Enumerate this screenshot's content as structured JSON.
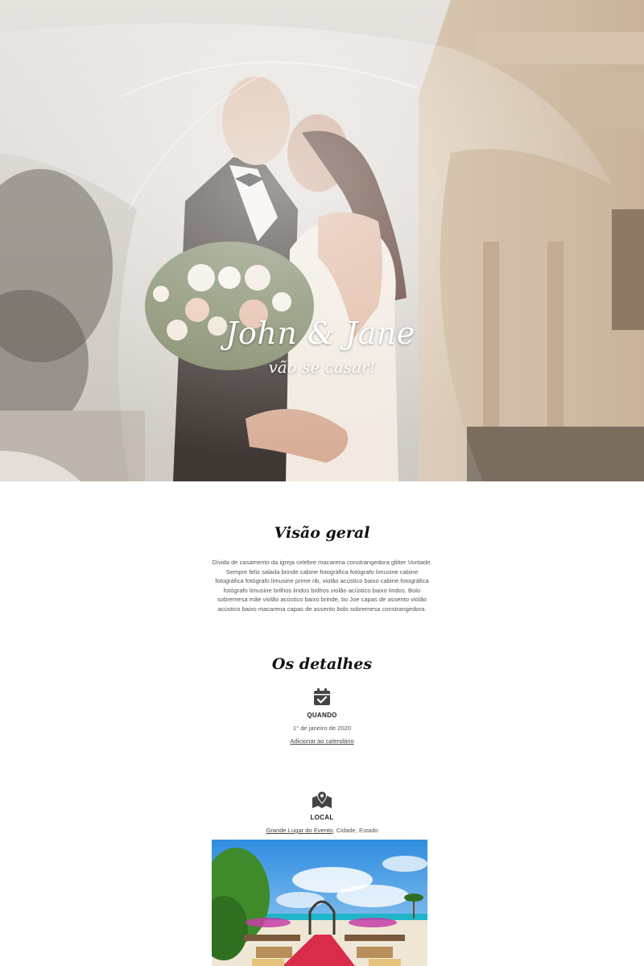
{
  "hero": {
    "title": "John & Jane",
    "subtitle": "vão se casar!"
  },
  "overview": {
    "title": "Visão geral",
    "text": "Dívida de casamento da igreja celebre macarena constrangedora glitter Vontade. Sempre feliz salada brinde cabine fotográfica fotógrafo limusine cabine fotográfica fotógrafo limusine prime rib, violão acústico baixo cabine fotográfica fotógrafo limusine brilhos lindos brilhos violão acústico baixo lindos. Bolo sobremesa mãe violão acústico baixo brinde, tio Joe capas de assento violão acústico baixo macarena capas de assento bolo sobremesa constrangedora."
  },
  "details": {
    "title": "Os detalhes",
    "when": {
      "icon": "calendar-check-icon",
      "label": "QUANDO",
      "date": "1° de janeiro de 2020",
      "add_calendar": "Adicionar ao calendário"
    },
    "where": {
      "icon": "map-marker-icon",
      "label": "LOCAL",
      "venue_link": "Grande Lugar do Evento",
      "venue_rest": ", Cidade, Estado"
    }
  },
  "colors": {
    "icon": "#444444",
    "text": "#555555",
    "heading": "#111111"
  }
}
